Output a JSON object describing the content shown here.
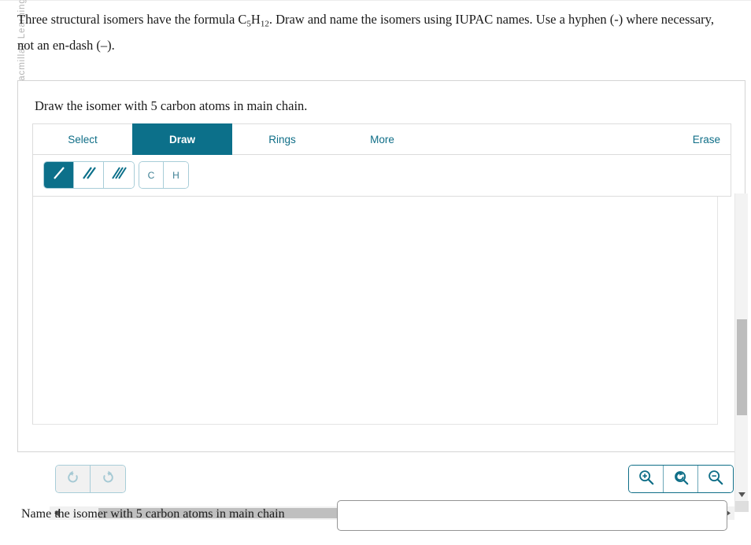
{
  "branding": {
    "copyright": "© Macmillan Learning"
  },
  "prompt": {
    "part1": "Three structural isomers have the formula C",
    "sub1": "5",
    "part2": "H",
    "sub2": "12",
    "part3": ". Draw and name the isomers using IUPAC names. Use a hyphen (-) where necessary, not an en-dash (–)."
  },
  "panel": {
    "title": "Draw the isomer with 5 carbon atoms in main chain.",
    "editor": {
      "tabs": [
        {
          "label": "Select",
          "active": false
        },
        {
          "label": "Draw",
          "active": true
        },
        {
          "label": "Rings",
          "active": false
        },
        {
          "label": "More",
          "active": false
        }
      ],
      "erase_label": "Erase",
      "bond_tools": [
        {
          "name": "single-bond",
          "selected": true
        },
        {
          "name": "double-bond",
          "selected": false
        },
        {
          "name": "triple-bond",
          "selected": false
        }
      ],
      "atom_tools": [
        {
          "label": "C"
        },
        {
          "label": "H"
        }
      ],
      "history_buttons": [
        {
          "name": "undo-icon",
          "enabled": false
        },
        {
          "name": "redo-icon",
          "enabled": false
        }
      ],
      "zoom_buttons": [
        {
          "name": "zoom-in-icon"
        },
        {
          "name": "zoom-reset-icon"
        },
        {
          "name": "zoom-out-icon"
        }
      ],
      "canvas": {
        "content": ""
      }
    }
  },
  "answer": {
    "label": "Name the isomer with 5 carbon atoms in main chain",
    "value": "",
    "placeholder": ""
  },
  "colors": {
    "accent": "#0c708a",
    "link": "#0f6e87",
    "border": "#dcdcdc",
    "tool_border": "#a8cdd8",
    "scroll_thumb": "#bdbdbd"
  }
}
